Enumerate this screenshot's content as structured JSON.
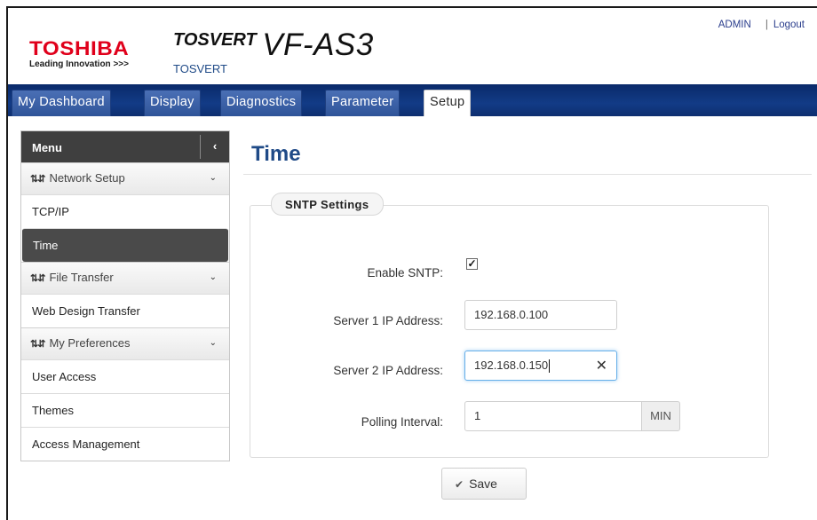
{
  "header": {
    "brand": "TOSHIBA",
    "brand_tagline": "Leading Innovation >>>",
    "product_series": "TOSVERT",
    "product_model": "VF-AS3",
    "subtitle": "TOSVERT",
    "user_label": "ADMIN",
    "separator": "|",
    "logout_label": "Logout",
    "brand_color": "#e0001b",
    "accent_color": "#1f4a87"
  },
  "tabs": [
    {
      "label": "My Dashboard",
      "active": false
    },
    {
      "label": "Display",
      "active": false
    },
    {
      "label": "Diagnostics",
      "active": false
    },
    {
      "label": "Parameter",
      "active": false
    },
    {
      "label": "Setup",
      "active": true
    }
  ],
  "sidebar": {
    "title": "Menu",
    "collapse_icon": "‹",
    "groups": [
      {
        "label": "Network Setup",
        "icon": "network-icon",
        "items": [
          {
            "label": "TCP/IP",
            "active": false
          },
          {
            "label": "Time",
            "active": true
          }
        ]
      },
      {
        "label": "File Transfer",
        "icon": "network-icon",
        "items": [
          {
            "label": "Web Design Transfer",
            "active": false
          }
        ]
      },
      {
        "label": "My Preferences",
        "icon": "network-icon",
        "items": [
          {
            "label": "User Access",
            "active": false
          },
          {
            "label": "Themes",
            "active": false
          },
          {
            "label": "Access Management",
            "active": false
          }
        ]
      }
    ]
  },
  "main": {
    "page_title": "Time",
    "section_title": "SNTP Settings",
    "enable_sntp_label": "Enable SNTP:",
    "enable_sntp_checked": true,
    "server1_label": "Server 1 IP Address:",
    "server1_value": "192.168.0.100",
    "server2_label": "Server 2 IP Address:",
    "server2_value": "192.168.0.150",
    "polling_label": "Polling Interval:",
    "polling_value": "1",
    "polling_unit": "MIN",
    "save_label": "Save"
  }
}
